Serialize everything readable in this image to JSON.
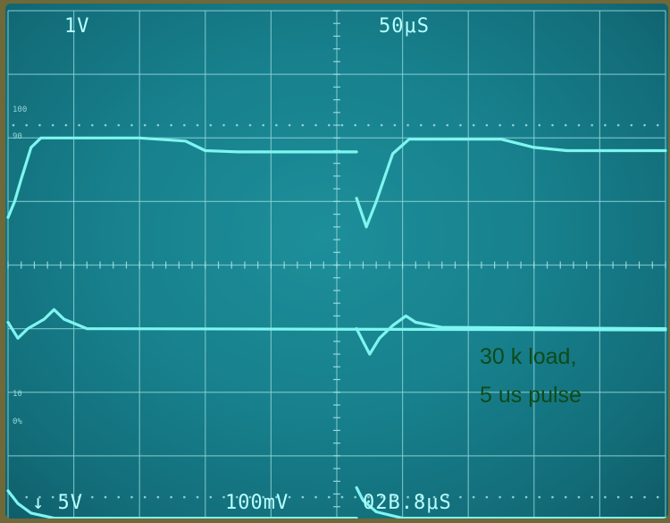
{
  "scope": {
    "top_left_readout": "1V",
    "top_right_readout": "50μS",
    "bottom_readouts": [
      "↓ 5V",
      "100mV",
      "02B.8μS"
    ],
    "graticule_labels": [
      "100",
      "90",
      "10",
      "0%"
    ],
    "annotation_line1": "30 k load,",
    "annotation_line2": "5  us pulse"
  },
  "chart_data": {
    "type": "line",
    "title": "",
    "xlabel": "",
    "ylabel": "",
    "x_divisions": 10,
    "y_divisions": 8,
    "time_per_div": "50μS",
    "grid": true,
    "series": [
      {
        "color": "#7ff5f0",
        "points": [
          [
            0.0,
            4.75
          ],
          [
            0.1,
            5.0
          ],
          [
            0.2,
            5.35
          ],
          [
            0.35,
            5.85
          ],
          [
            0.5,
            6.0
          ],
          [
            2.0,
            6.0
          ],
          [
            2.7,
            5.95
          ],
          [
            3.0,
            5.8
          ],
          [
            3.5,
            5.78
          ],
          [
            5.3,
            5.78
          ]
        ]
      },
      {
        "color": "#7ff5f0",
        "points": [
          [
            5.3,
            5.05
          ],
          [
            5.45,
            4.6
          ],
          [
            5.6,
            5.0
          ],
          [
            5.85,
            5.75
          ],
          [
            6.1,
            5.98
          ],
          [
            7.5,
            5.98
          ],
          [
            8.0,
            5.85
          ],
          [
            8.5,
            5.8
          ],
          [
            10.0,
            5.8
          ]
        ]
      },
      {
        "color": "#7ff5f0",
        "points": [
          [
            0.0,
            3.1
          ],
          [
            0.15,
            2.85
          ],
          [
            0.3,
            3.0
          ],
          [
            0.55,
            3.15
          ],
          [
            0.7,
            3.3
          ],
          [
            0.85,
            3.15
          ],
          [
            1.2,
            3.0
          ],
          [
            10.0,
            2.98
          ]
        ]
      },
      {
        "color": "#7ff5f0",
        "points": [
          [
            5.3,
            3.0
          ],
          [
            5.4,
            2.8
          ],
          [
            5.5,
            2.6
          ],
          [
            5.65,
            2.85
          ],
          [
            5.85,
            3.05
          ],
          [
            6.05,
            3.2
          ],
          [
            6.2,
            3.1
          ],
          [
            6.6,
            3.02
          ],
          [
            10.0,
            3.0
          ]
        ]
      },
      {
        "color": "#7ff5f0",
        "points": [
          [
            0.0,
            0.45
          ],
          [
            0.15,
            0.25
          ],
          [
            0.35,
            0.1
          ],
          [
            0.7,
            0.02
          ],
          [
            5.3,
            0.02
          ]
        ]
      },
      {
        "color": "#7ff5f0",
        "points": [
          [
            5.3,
            0.5
          ],
          [
            5.4,
            0.3
          ],
          [
            5.6,
            0.12
          ],
          [
            6.0,
            0.02
          ],
          [
            10.0,
            0.02
          ]
        ]
      }
    ]
  }
}
